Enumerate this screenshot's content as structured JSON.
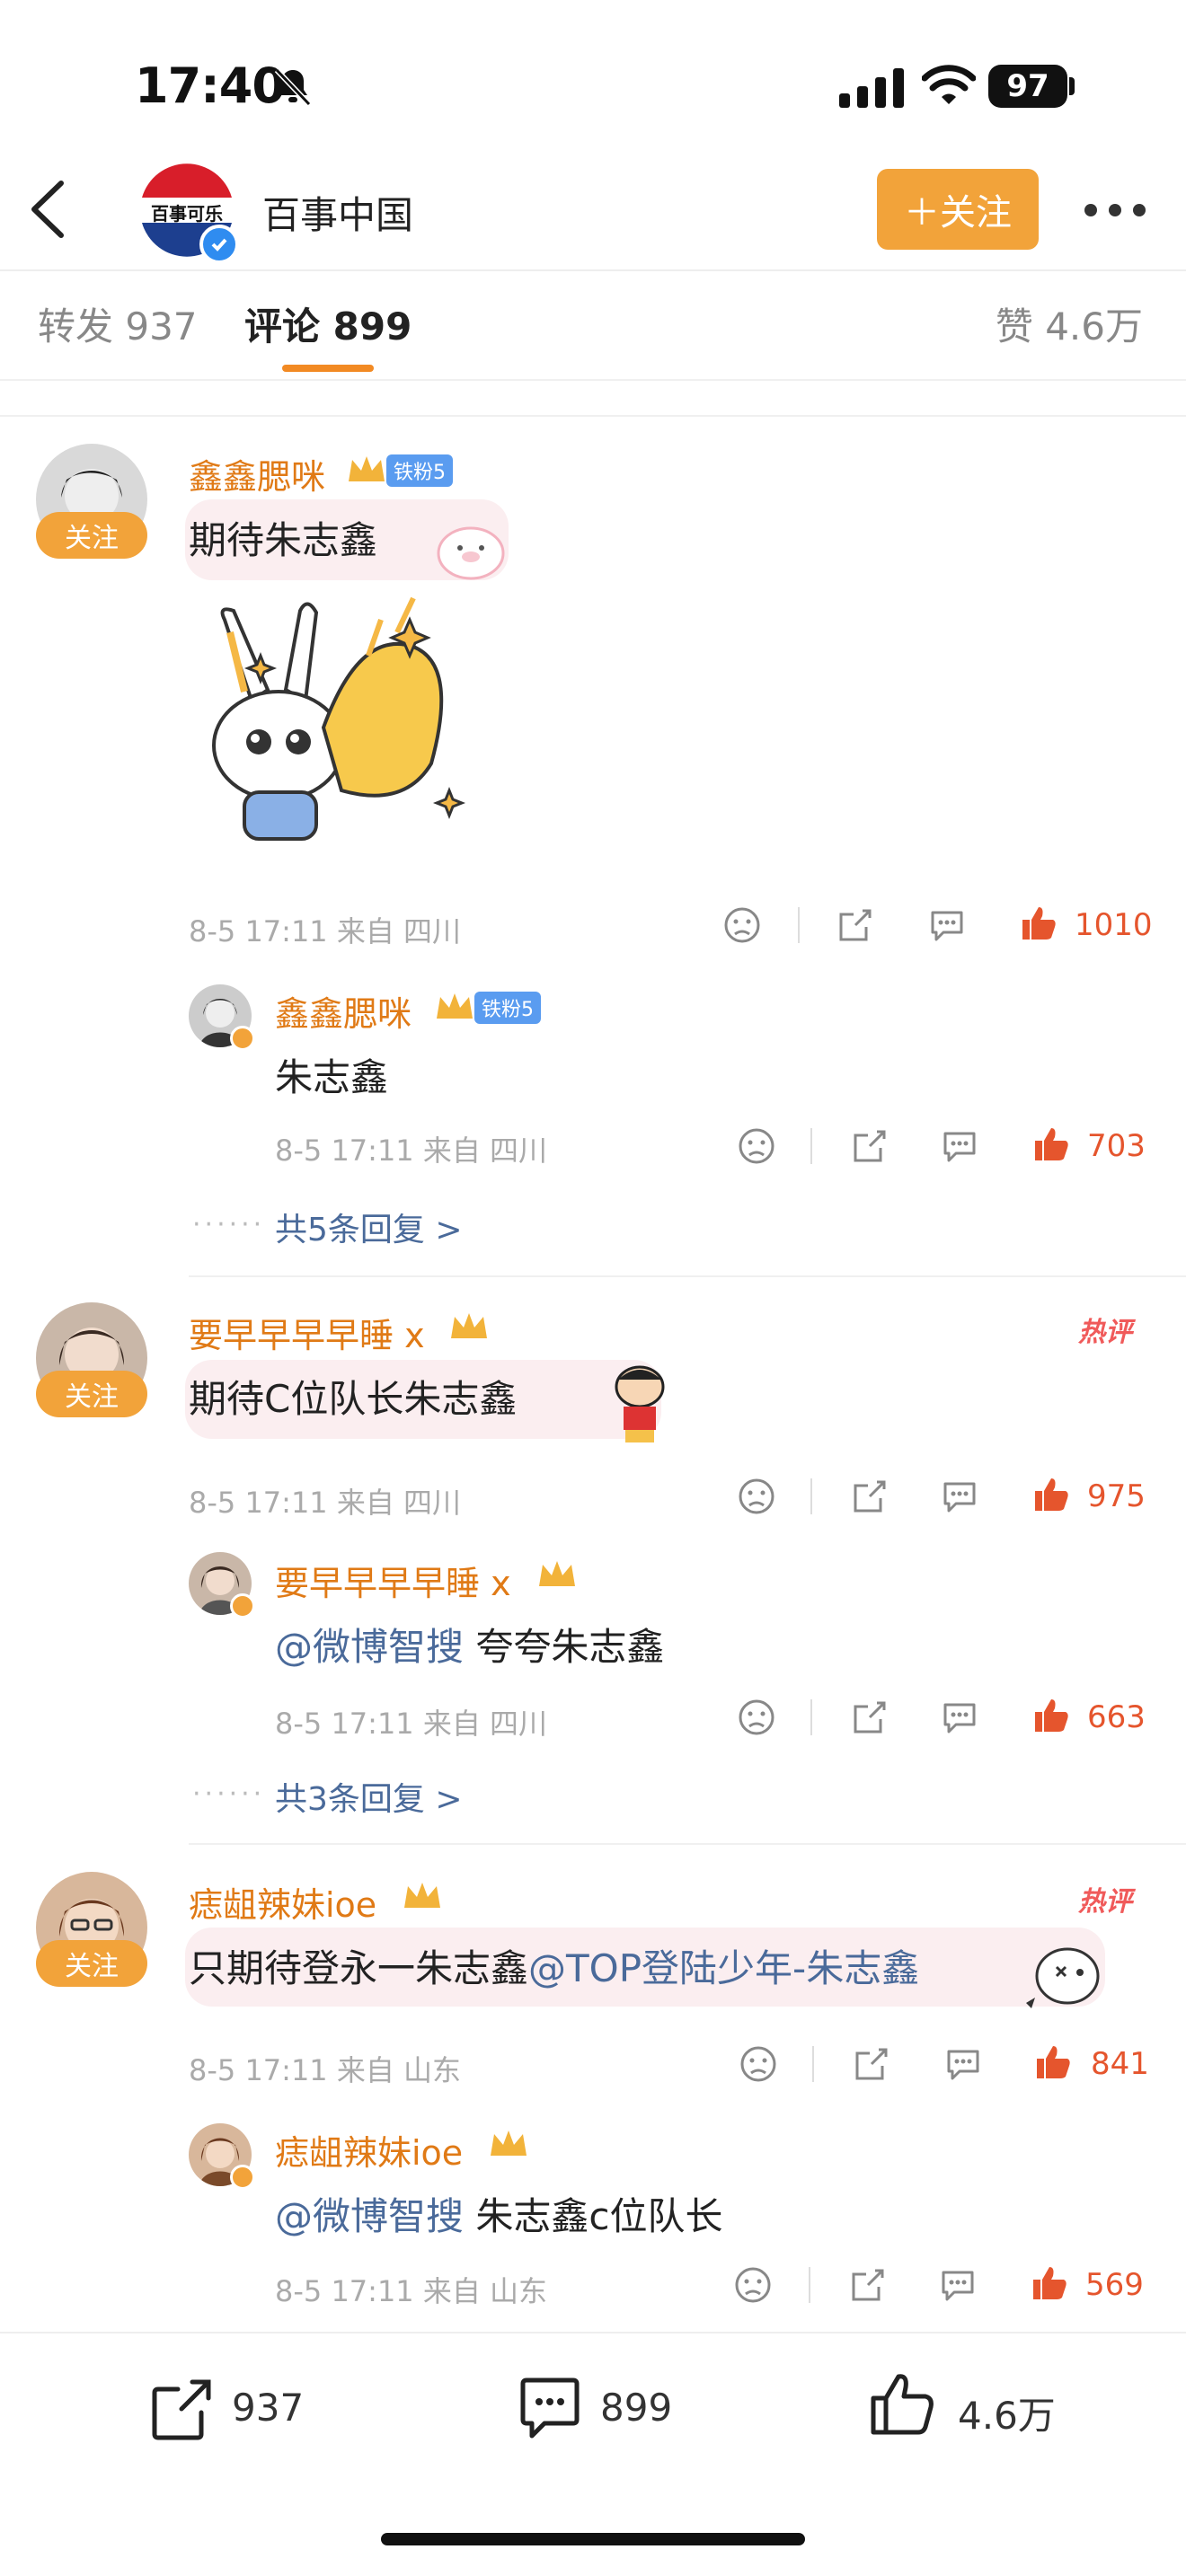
{
  "status_bar": {
    "time": "17:40",
    "battery": "97"
  },
  "header": {
    "account_name": "百事中国",
    "follow_label": "＋关注",
    "avatar_text": "百事可乐"
  },
  "tabs": {
    "repost": "转发 937",
    "comments": "评论 899",
    "likes": "赞 4.6万"
  },
  "comments": [
    {
      "user": "鑫鑫腮咪",
      "fan_badge": "铁粉5",
      "follow_label": "关注",
      "text": "期待朱志鑫",
      "meta": "8-5 17:11 来自 四川",
      "likes": "1010",
      "reply": {
        "user": "鑫鑫腮咪",
        "fan_badge": "铁粉5",
        "text": "朱志鑫",
        "meta": "8-5 17:11 来自 四川",
        "likes": "703"
      },
      "more_replies": "共5条回复 >"
    },
    {
      "user": "要早早早早睡 x",
      "follow_label": "关注",
      "hot": "热评",
      "text": "期待C位队长朱志鑫",
      "meta": "8-5 17:11 来自 四川",
      "likes": "975",
      "reply": {
        "user": "要早早早早睡 x",
        "mention": "@微博智搜",
        "text": " 夸夸朱志鑫",
        "meta": "8-5 17:11 来自 四川",
        "likes": "663"
      },
      "more_replies": "共3条回复 >"
    },
    {
      "user": "痣龃辣妹ioe",
      "follow_label": "关注",
      "hot": "热评",
      "text": "只期待登永一朱志鑫",
      "mention": "@TOP登陆少年-朱志鑫",
      "meta": "8-5 17:11 来自 山东",
      "likes": "841",
      "reply": {
        "user": "痣龃辣妹ioe",
        "mention": "@微博智搜",
        "text": " 朱志鑫c位队长",
        "meta": "8-5 17:11 来自 山东",
        "likes": "569"
      }
    }
  ],
  "bottom_bar": {
    "repost": "937",
    "comment": "899",
    "like": "4.6万"
  },
  "colors": {
    "accent": "#f2a33a",
    "username": "#e07a16",
    "like": "#e5552d",
    "link": "#4a6a9a"
  }
}
